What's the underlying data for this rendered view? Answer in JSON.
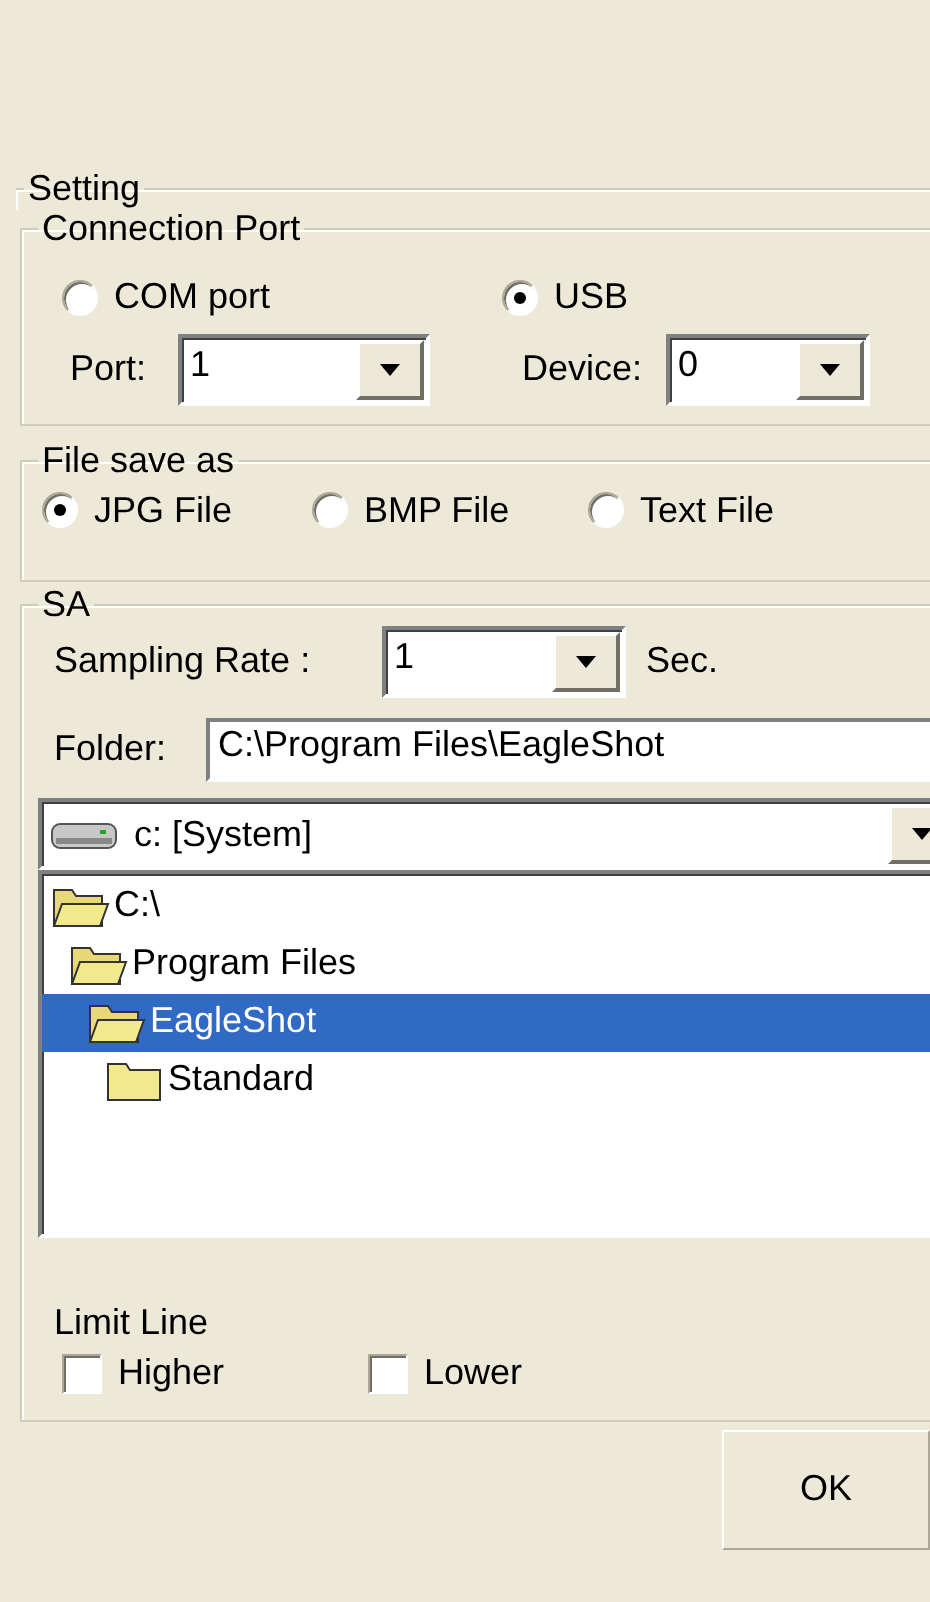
{
  "setting_title": "Setting",
  "connection_port": {
    "title": "Connection Port",
    "options": [
      {
        "label": "COM port",
        "selected": false
      },
      {
        "label": "USB",
        "selected": true
      }
    ],
    "port": {
      "label": "Port:",
      "value": "1"
    },
    "device": {
      "label": "Device:",
      "value": "0"
    }
  },
  "file_save_as": {
    "title": "File save as",
    "options": [
      {
        "label": "JPG File",
        "selected": true
      },
      {
        "label": "BMP File",
        "selected": false
      },
      {
        "label": "Text File",
        "selected": false
      }
    ]
  },
  "sa": {
    "title": "SA",
    "sampling_rate": {
      "label": "Sampling Rate :",
      "value": "1",
      "unit": "Sec."
    },
    "folder": {
      "label": "Folder:",
      "value": "C:\\Program Files\\EagleShot"
    },
    "drive": {
      "value": "c: [System]"
    },
    "tree": [
      {
        "label": "C:\\",
        "expanded": true,
        "selected": false,
        "children": [
          {
            "label": "Program Files",
            "expanded": true,
            "selected": false,
            "children": [
              {
                "label": "EagleShot",
                "expanded": true,
                "selected": true,
                "children": [
                  {
                    "label": "Standard",
                    "expanded": false,
                    "selected": false
                  }
                ]
              }
            ]
          }
        ]
      }
    ],
    "limit_line": {
      "title": "Limit Line",
      "options": [
        {
          "label": "Higher",
          "checked": false
        },
        {
          "label": "Lower",
          "checked": false
        }
      ]
    }
  },
  "buttons": [
    "OK"
  ]
}
